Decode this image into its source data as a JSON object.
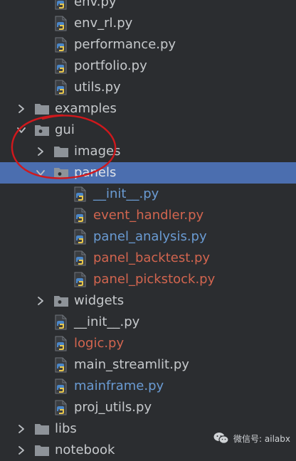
{
  "tree": {
    "rows": [
      {
        "label": "env.py",
        "type": "py",
        "color": "normal",
        "level": 2,
        "arrow": "none"
      },
      {
        "label": "env_rl.py",
        "type": "py",
        "color": "normal",
        "level": 2,
        "arrow": "none"
      },
      {
        "label": "performance.py",
        "type": "py",
        "color": "normal",
        "level": 2,
        "arrow": "none"
      },
      {
        "label": "portfolio.py",
        "type": "py",
        "color": "normal",
        "level": 2,
        "arrow": "none"
      },
      {
        "label": "utils.py",
        "type": "py",
        "color": "normal",
        "level": 2,
        "arrow": "none"
      },
      {
        "label": "examples",
        "type": "folder",
        "color": "normal",
        "level": 1,
        "arrow": "collapsed"
      },
      {
        "label": "gui",
        "type": "package",
        "color": "normal",
        "level": 1,
        "arrow": "expanded"
      },
      {
        "label": "images",
        "type": "folder",
        "color": "normal",
        "level": 2,
        "arrow": "collapsed"
      },
      {
        "label": "panels",
        "type": "package",
        "color": "normal",
        "level": 2,
        "arrow": "expanded",
        "selected": true
      },
      {
        "label": "__init__.py",
        "type": "py",
        "color": "blue",
        "level": 3,
        "arrow": "none"
      },
      {
        "label": "event_handler.py",
        "type": "py",
        "color": "red",
        "level": 3,
        "arrow": "none"
      },
      {
        "label": "panel_analysis.py",
        "type": "py",
        "color": "blue",
        "level": 3,
        "arrow": "none"
      },
      {
        "label": "panel_backtest.py",
        "type": "py",
        "color": "red",
        "level": 3,
        "arrow": "none"
      },
      {
        "label": "panel_pickstock.py",
        "type": "py",
        "color": "red",
        "level": 3,
        "arrow": "none"
      },
      {
        "label": "widgets",
        "type": "package",
        "color": "normal",
        "level": 2,
        "arrow": "collapsed"
      },
      {
        "label": "__init__.py",
        "type": "py",
        "color": "normal",
        "level": 2,
        "arrow": "none"
      },
      {
        "label": "logic.py",
        "type": "py",
        "color": "red",
        "level": 2,
        "arrow": "none"
      },
      {
        "label": "main_streamlit.py",
        "type": "py",
        "color": "normal",
        "level": 2,
        "arrow": "none"
      },
      {
        "label": "mainframe.py",
        "type": "py",
        "color": "blue",
        "level": 2,
        "arrow": "none"
      },
      {
        "label": "proj_utils.py",
        "type": "py",
        "color": "normal",
        "level": 2,
        "arrow": "none"
      },
      {
        "label": "libs",
        "type": "folder",
        "color": "normal",
        "level": 1,
        "arrow": "collapsed"
      },
      {
        "label": "notebook",
        "type": "folder",
        "color": "normal",
        "level": 1,
        "arrow": "collapsed"
      }
    ]
  },
  "colors": {
    "background": "#2b2d30",
    "selection": "#4b6eaf",
    "text_normal": "#c6c9cc",
    "text_modified": "#6a9bd3",
    "text_new": "#d2654f",
    "annotation_circle": "#d0181c"
  },
  "watermark": {
    "text": "微信号: ailabx",
    "icon": "wechat-icon"
  }
}
